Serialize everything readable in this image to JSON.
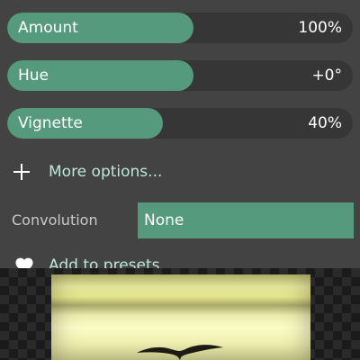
{
  "sliders": [
    {
      "label": "Amount",
      "value": "100%",
      "fill_fraction": 0.54
    },
    {
      "label": "Hue",
      "value": "+0°",
      "fill_fraction": 0.54
    },
    {
      "label": "Vignette",
      "value": "40%",
      "fill_fraction": 0.45
    }
  ],
  "more_options": {
    "label": "More options...",
    "icon": "plus-icon"
  },
  "convolution": {
    "label": "Convolution",
    "selected": "None"
  },
  "presets": {
    "label": "Add to presets",
    "icon": "heart-icon"
  },
  "colors": {
    "accent": "#559a7c",
    "panel_bg": "#434343",
    "track": "#363636",
    "link_text": "#bfe6d8"
  }
}
